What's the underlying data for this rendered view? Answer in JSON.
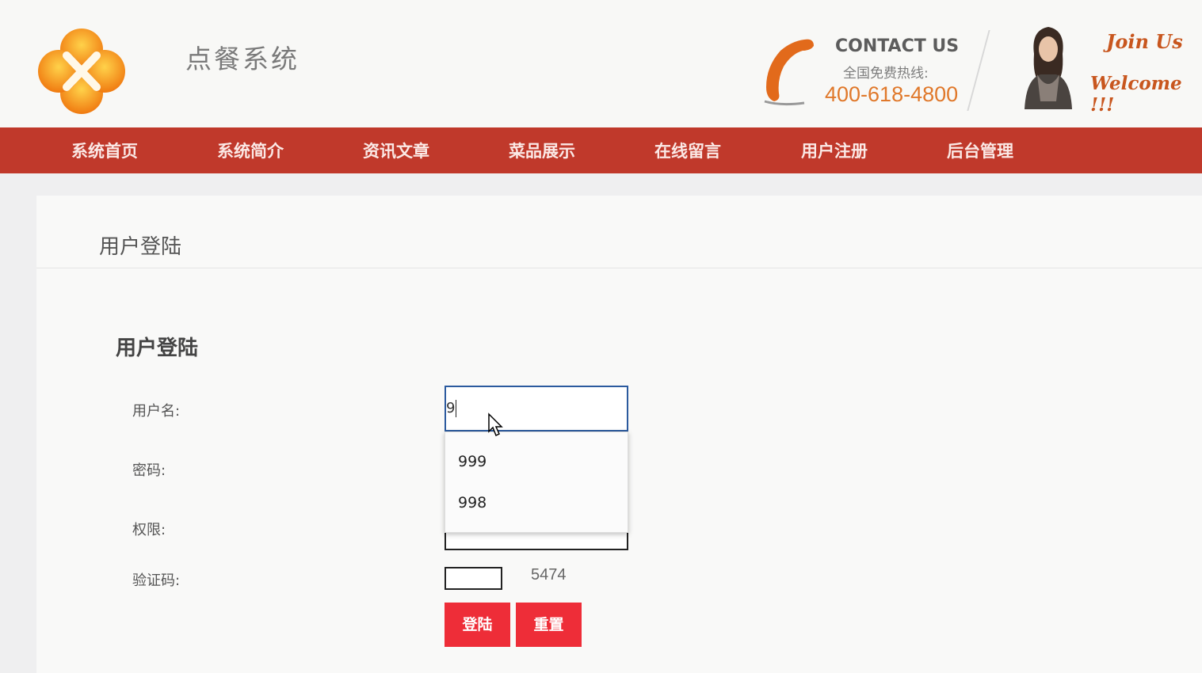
{
  "header": {
    "site_title": "点餐系统",
    "contact_title": "CONTACT US",
    "contact_sub": "全国免费热线:",
    "contact_phone": "400-618-4800",
    "join_text": "Join Us",
    "welcome_text": "Welcome !!!"
  },
  "nav": {
    "items": [
      "系统首页",
      "系统简介",
      "资讯文章",
      "菜品展示",
      "在线留言",
      "用户注册",
      "后台管理"
    ]
  },
  "panel": {
    "title": "用户登陆"
  },
  "form": {
    "title": "用户登陆",
    "username_label": "用户名:",
    "username_value": "9",
    "password_label": "密码:",
    "role_label": "权限:",
    "captcha_label": "验证码:",
    "captcha_code": "5474",
    "login_button": "登陆",
    "reset_button": "重置"
  },
  "autocomplete": {
    "options": [
      "999",
      "998"
    ]
  },
  "colors": {
    "nav_bg": "#c0392b",
    "button_bg": "#ee2d38",
    "phone_orange": "#e0782a",
    "focus_border": "#2b5a9e"
  }
}
